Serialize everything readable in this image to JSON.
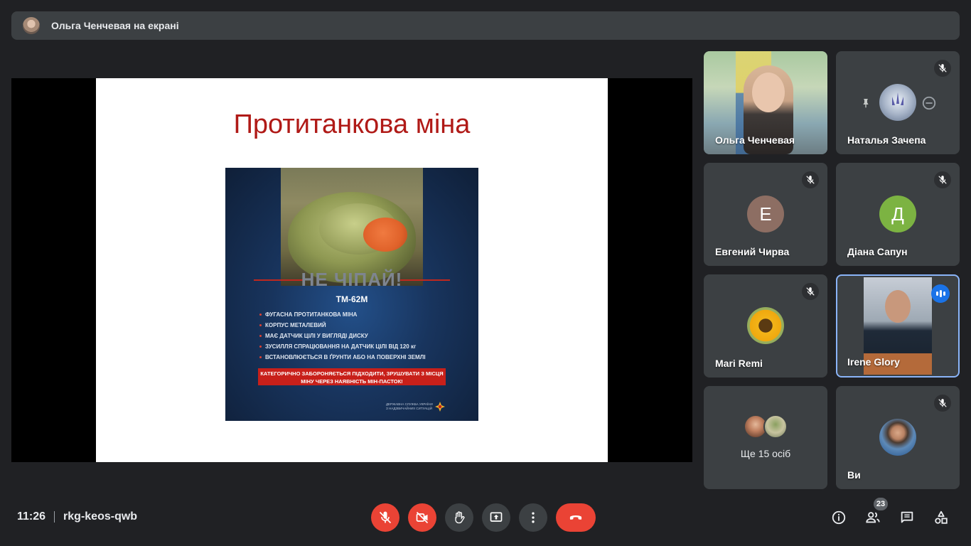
{
  "presenting": {
    "text": "Ольга Ченчевая на екрані"
  },
  "slide": {
    "title": "Протитанкова міна",
    "poster": {
      "headline": "НЕ ЧІПАЙ!",
      "model": "ТМ-62М",
      "items": [
        "ФУГАСНА ПРОТИТАНКОВА МІНА",
        "КОРПУС МЕТАЛЕВИЙ",
        "МАЄ ДАТЧИК ЦІЛІ У ВИГЛЯДІ ДИСКУ",
        "ЗУСИЛЛЯ СПРАЦЮВАННЯ НА ДАТЧИК ЦІЛІ ВІД 120 кг",
        "ВСТАНОВЛЮЄТЬСЯ В ҐРУНТИ АБО НА ПОВЕРХНІ ЗЕМЛІ"
      ],
      "warning": "КАТЕГОРИЧНО ЗАБОРОНЯЄТЬСЯ ПІДХОДИТИ, ЗРУШУВАТИ З МІСЦЯ МІНУ ЧЕРЕЗ НАЯВНІСТЬ МІН-ПАСТОК!",
      "org": "ДЕРЖАВНА СЛУЖБА УКРАЇНИ З НАДЗВИЧАЙНИХ СИТУАЦІЙ"
    }
  },
  "participants": [
    {
      "name": "Ольга Ченчевая",
      "type": "video"
    },
    {
      "name": "Наталья Зачепа",
      "type": "avatar-image",
      "muted": true
    },
    {
      "name": "Евгений Чирва",
      "type": "letter",
      "letter": "Е",
      "color": "#8d6e63",
      "muted": true
    },
    {
      "name": "Діана Сапун",
      "type": "letter",
      "letter": "Д",
      "color": "#7cb342",
      "muted": true
    },
    {
      "name": "Mari Remi",
      "type": "avatar-image",
      "muted": true
    },
    {
      "name": "Irene Glory",
      "type": "video",
      "speaking": true
    },
    {
      "name": "Ще 15 осіб",
      "type": "others"
    },
    {
      "name": "Ви",
      "type": "avatar-image",
      "muted": true
    }
  ],
  "footer": {
    "time": "11:26",
    "meeting_code": "rkg-keos-qwb",
    "people_count": "23"
  },
  "colors": {
    "background": "#202124",
    "tile": "#3c4043",
    "danger": "#ea4335",
    "accent": "#1a73e8",
    "slide_title": "#b01a17"
  },
  "icons": {
    "mic": "mic-off-icon",
    "camera": "camera-off-icon",
    "hand": "raise-hand-icon",
    "present": "present-screen-icon",
    "more": "more-vert-icon",
    "hangup": "call-end-icon",
    "info": "info-icon",
    "people": "people-icon",
    "chat": "chat-icon",
    "activities": "activities-icon"
  }
}
